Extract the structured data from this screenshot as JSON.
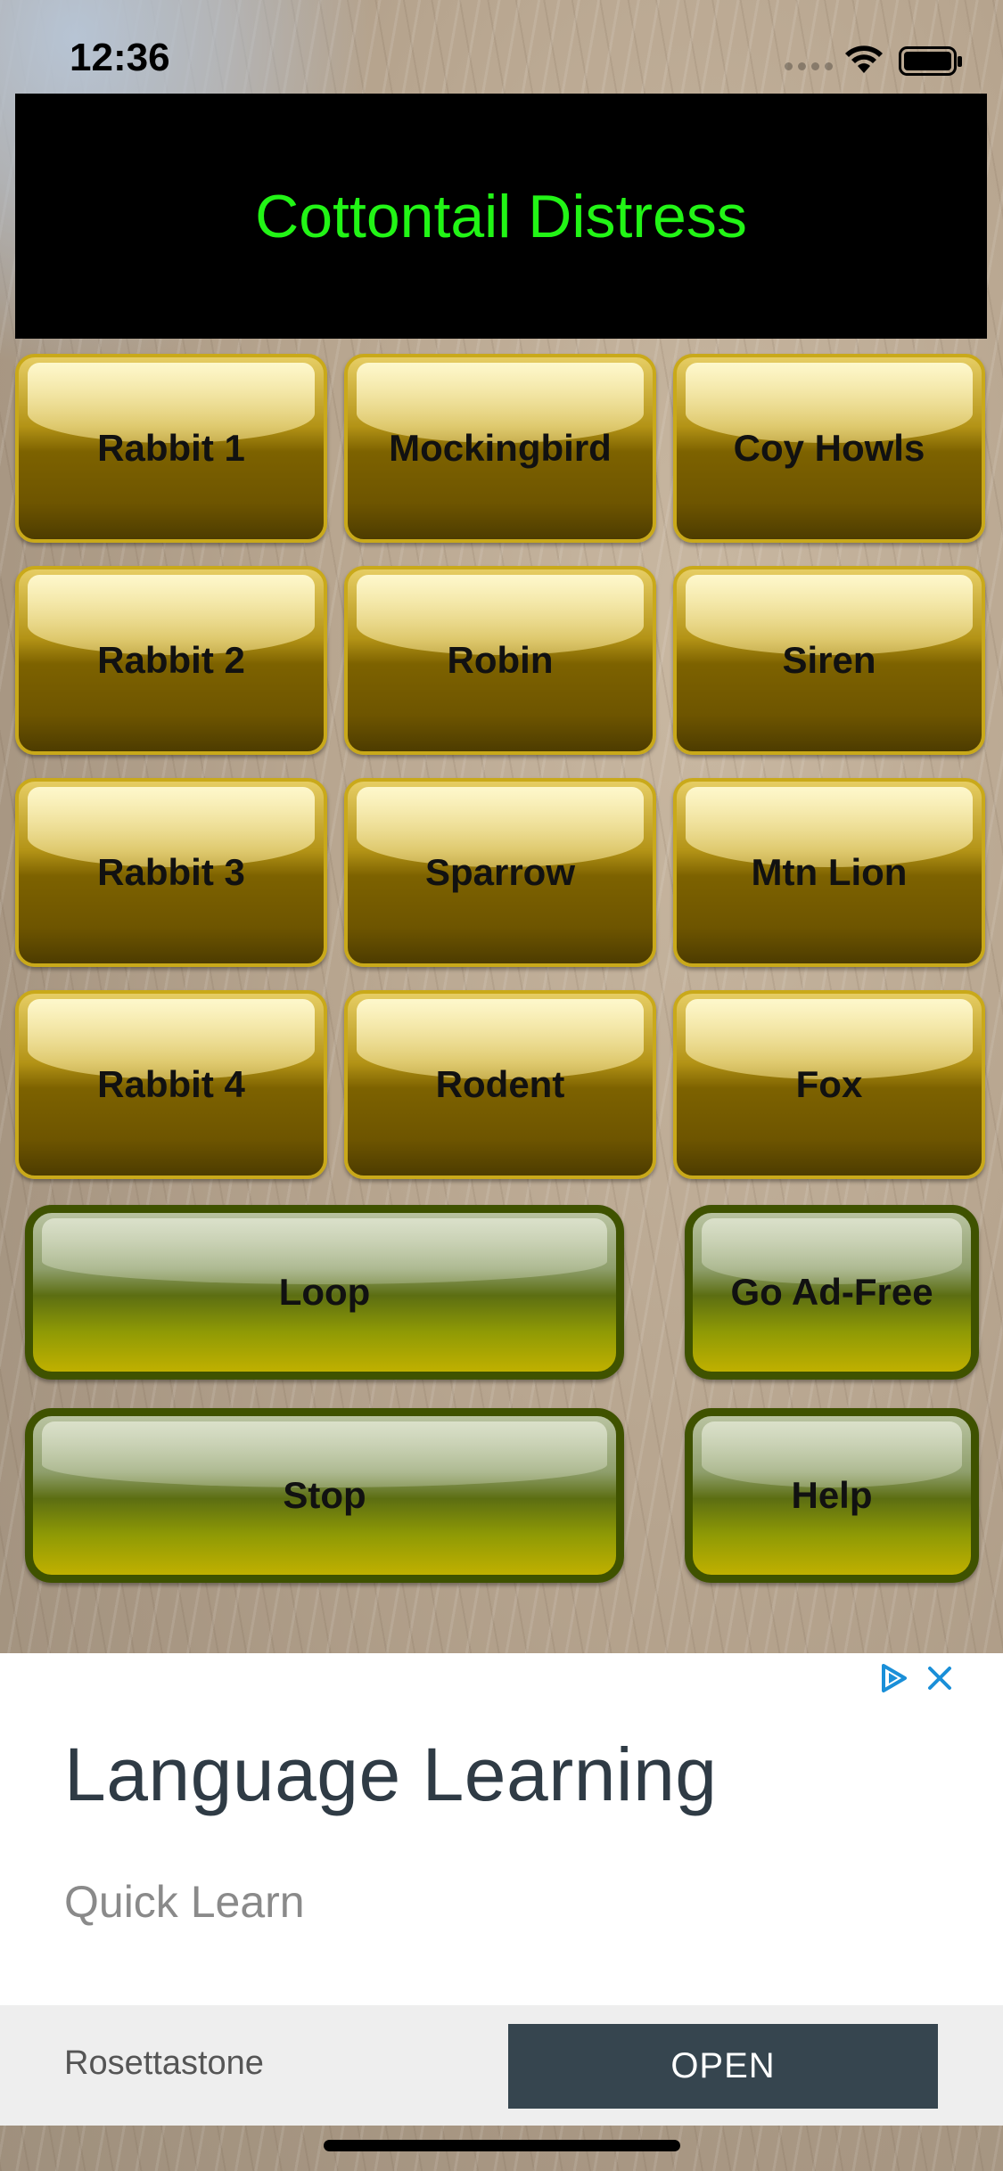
{
  "status_bar": {
    "time": "12:36"
  },
  "app": {
    "title": "Cottontail Distress",
    "title_color": "#22f516"
  },
  "sound_buttons": [
    {
      "label": "Rabbit 1"
    },
    {
      "label": "Mockingbird"
    },
    {
      "label": "Coy Howls"
    },
    {
      "label": "Rabbit 2"
    },
    {
      "label": "Robin"
    },
    {
      "label": "Siren"
    },
    {
      "label": "Rabbit 3"
    },
    {
      "label": "Sparrow"
    },
    {
      "label": "Mtn Lion"
    },
    {
      "label": "Rabbit 4"
    },
    {
      "label": "Rodent"
    },
    {
      "label": "Fox"
    }
  ],
  "controls": {
    "loop": "Loop",
    "go_ad_free": "Go Ad-Free",
    "stop": "Stop",
    "help": "Help"
  },
  "ad": {
    "headline": "Language Learning",
    "subtitle": "Quick Learn",
    "advertiser": "Rosettastone",
    "cta": "OPEN",
    "choices_icon": "adchoices-icon",
    "close_icon": "close-icon",
    "accent_color": "#1a8fd8"
  }
}
